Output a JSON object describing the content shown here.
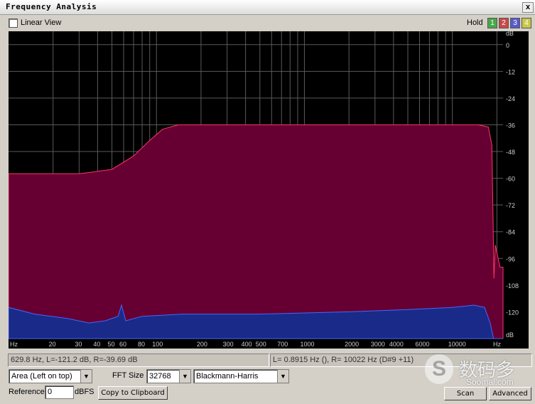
{
  "window": {
    "title": "Frequency Analysis",
    "close_glyph": "x"
  },
  "toolbar": {
    "linear_view_label": "Linear View",
    "linear_view_checked": false,
    "hold_label": "Hold",
    "hold_buttons": [
      {
        "label": "1",
        "color": "#4aa84a"
      },
      {
        "label": "2",
        "color": "#c84a4a"
      },
      {
        "label": "3",
        "color": "#5a5ac8"
      },
      {
        "label": "4",
        "color": "#c8c84a"
      }
    ]
  },
  "plot": {
    "db_ticks": [
      "dB",
      "0",
      "-12",
      "-24",
      "-36",
      "-48",
      "-60",
      "-72",
      "-84",
      "-96",
      "-108",
      "-120",
      "dB"
    ],
    "hz_ticks": [
      "Hz",
      "20",
      "30",
      "40",
      "50",
      "60",
      "80",
      "100",
      "200",
      "300",
      "400",
      "500",
      "700",
      "1000",
      "2000",
      "3000",
      "4000",
      "6000",
      "10000",
      "Hz"
    ],
    "colors": {
      "background": "#000000",
      "grid": "#5a5a5a",
      "left_channel": "#660033",
      "left_edge": "#ff3366",
      "right_channel": "#1a2a88",
      "right_edge": "#4466ff"
    }
  },
  "status": {
    "cursor_readout": "629.8 Hz, L=-121.2 dB, R=-39.69 dB",
    "peak_readout": "L= 0.8915 Hz (), R=  10022 Hz (D#9 +11)"
  },
  "controls": {
    "display_mode": "Area (Left on top)",
    "fft_size_label": "FFT Size",
    "fft_size": "32768",
    "window_function": "Blackmann-Harris",
    "reference_label": "Reference",
    "reference_value": "0",
    "reference_unit": "dBFS",
    "copy_button": "Copy to Clipboard",
    "scan_button": "Scan",
    "advanced_button": "Advanced"
  },
  "watermark": {
    "cn": "数码多",
    "en": "Soomal.com",
    "logo": "S"
  }
}
